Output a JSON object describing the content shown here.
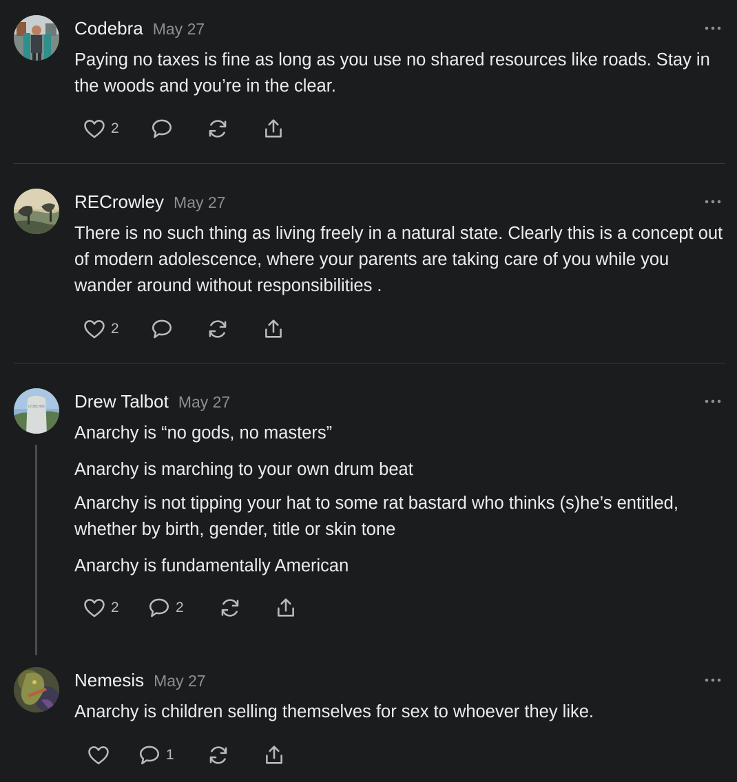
{
  "comments": [
    {
      "author": "Codebra",
      "date": "May 27",
      "paragraphs": [
        "Paying no taxes is fine as long as you use no shared resources like roads. Stay in the woods and you’re in the clear."
      ],
      "likes": "2",
      "replies": ""
    },
    {
      "author": "RECrowley",
      "date": "May 27",
      "paragraphs": [
        "There is no such thing as living freely in a natural state. Clearly this is a concept out of modern adolescence, where your parents are taking care of you while you wander around without responsibilities ."
      ],
      "likes": "2",
      "replies": ""
    },
    {
      "author": "Drew Talbot",
      "date": "May 27",
      "avatar_text": "LIVE FREE OR DIE",
      "paragraphs": [
        "Anarchy is “no gods, no masters”",
        "Anarchy is marching to your own drum beat",
        "Anarchy is not tipping your hat to some rat bastard who thinks (s)he’s entitled, whether by birth, gender, title or skin tone",
        "Anarchy is fundamentally American"
      ],
      "likes": "2",
      "replies": "2"
    },
    {
      "author": "Nemesis",
      "date": "May 27",
      "paragraphs": [
        "Anarchy is children selling themselves for sex to whoever they like."
      ],
      "likes": "",
      "replies": "1"
    }
  ],
  "icons": {
    "like": "heart-icon",
    "reply": "comment-bubble-icon",
    "restack": "restack-icon",
    "share": "share-icon",
    "more": "more-dots-icon"
  },
  "colors": {
    "background": "#1b1c1e",
    "text": "#ececee",
    "muted": "#8c8e93",
    "icon": "#b8babf",
    "divider": "#3a3b3e"
  }
}
